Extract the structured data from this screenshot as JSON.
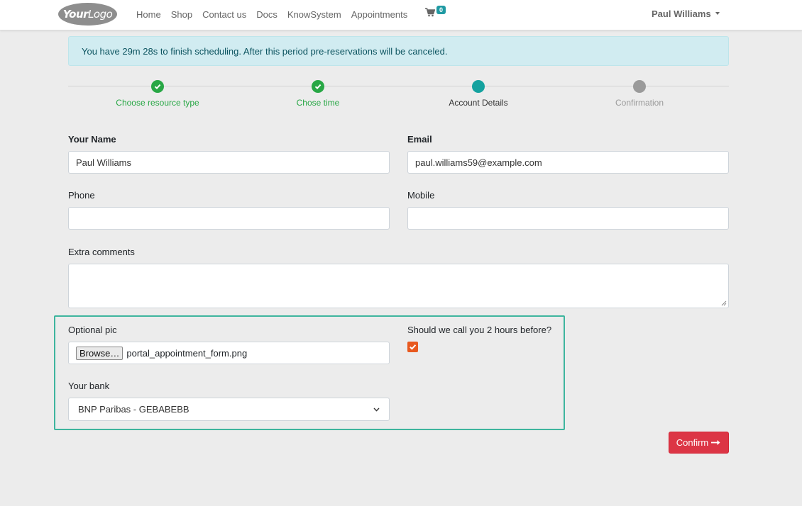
{
  "navbar": {
    "logo_text_bold": "Your",
    "logo_text_rest": "Logo",
    "links": [
      "Home",
      "Shop",
      "Contact us",
      "Docs",
      "KnowSystem",
      "Appointments"
    ],
    "cart_count": "0",
    "user_name": "Paul Williams"
  },
  "alert": {
    "message": "You have 29m 28s to finish scheduling. After this period pre-reservations will be canceled."
  },
  "steps": [
    {
      "label": "Choose resource type",
      "state": "done"
    },
    {
      "label": "Chose time",
      "state": "done"
    },
    {
      "label": "Account Details",
      "state": "current"
    },
    {
      "label": "Confirmation",
      "state": "future"
    }
  ],
  "form": {
    "name_label": "Your Name",
    "name_value": "Paul Williams",
    "email_label": "Email",
    "email_value": "paul.williams59@example.com",
    "phone_label": "Phone",
    "phone_value": "",
    "mobile_label": "Mobile",
    "mobile_value": "",
    "comments_label": "Extra comments",
    "pic_label": "Optional pic",
    "browse_label": "Browse…",
    "file_name": "portal_appointment_form.png",
    "call_label": "Should we call you 2 hours before?",
    "call_checked": true,
    "bank_label": "Your bank",
    "bank_value": "BNP Paribas - GEBABEBB",
    "confirm_label": "Confirm"
  },
  "colors": {
    "step_done": "#28a745",
    "step_current": "#14a29f",
    "step_future": "#9a9a9a",
    "highlight": "#3eb59e",
    "confirm": "#dc3545",
    "checkbox": "#e8591f"
  }
}
